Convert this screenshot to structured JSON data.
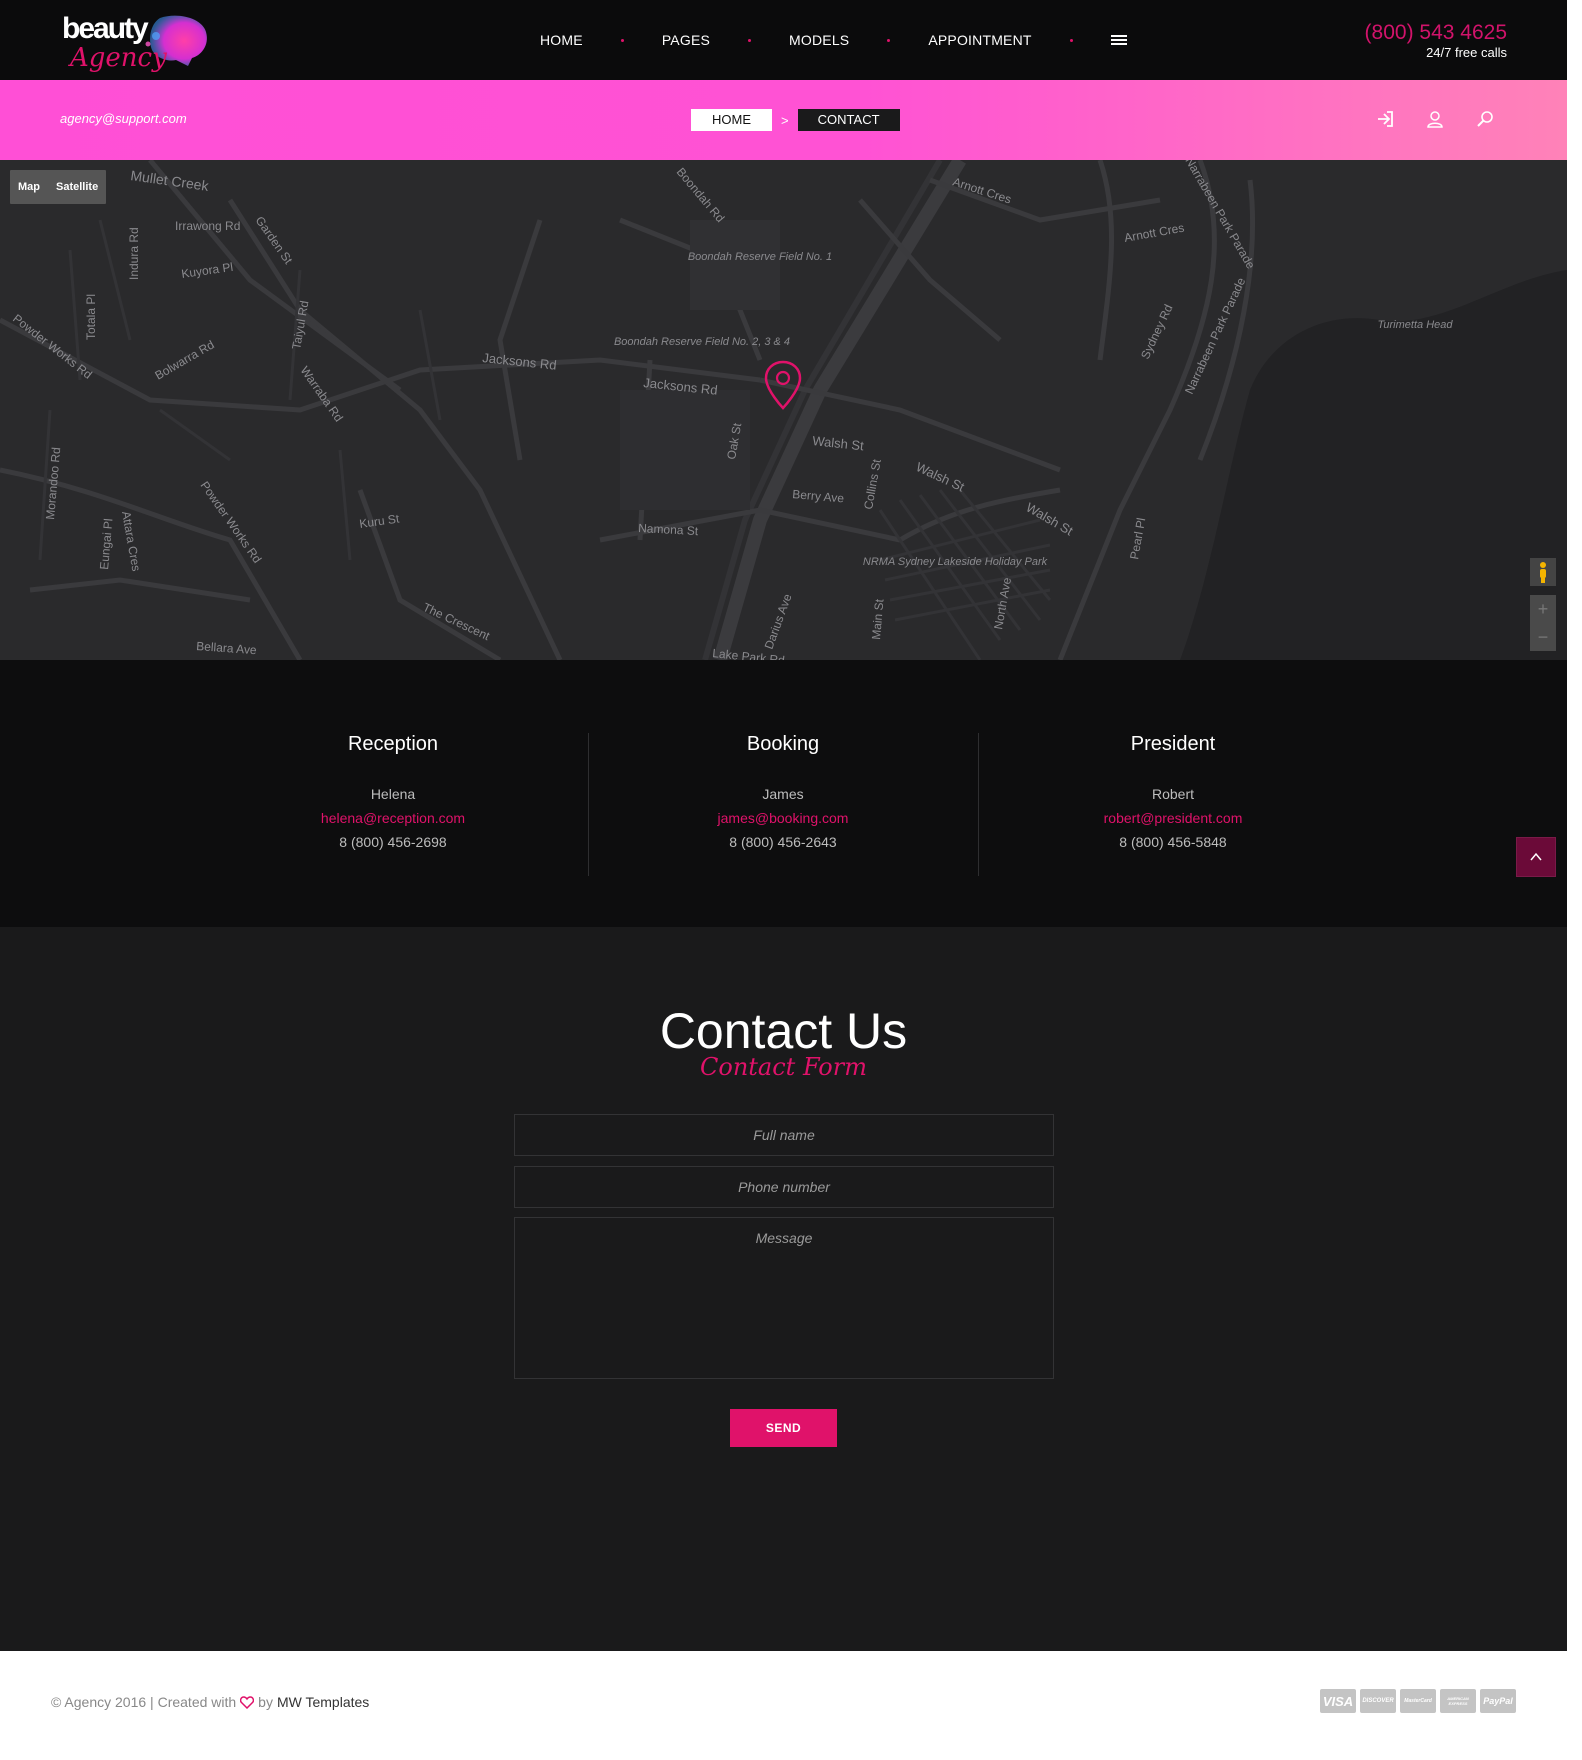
{
  "header": {
    "logo_word": "beauty",
    "logo_script": "Agency",
    "nav": [
      "HOME",
      "PAGES",
      "MODELS",
      "APPOINTMENT"
    ],
    "phone": "(800) 543 4625",
    "phone_sub": "24/7 free calls"
  },
  "topbar": {
    "email": "agency@support.com",
    "breadcrumb_home": "HOME",
    "breadcrumb_sep": ">",
    "breadcrumb_current": "CONTACT"
  },
  "map": {
    "toggle": [
      "Map",
      "Satellite"
    ],
    "labels": {
      "mullet_creek": "Mullet Creek",
      "irrawong_rd": "Irrawong Rd",
      "garden_st": "Garden St",
      "kuyora_pl": "Kuyora Pl",
      "indura_rd": "Indura Rd",
      "totala_pl": "Totala Pl",
      "powder_works_rd": "Powder Works Rd",
      "bolwarra_rd": "Bolwarra Rd",
      "taiyul_rd": "Taiyul Rd",
      "warraba_rd": "Warraba Rd",
      "jacksons_rd": "Jacksons Rd",
      "boondah_rd": "Boondah Rd",
      "boondah_field_1": "Boondah Reserve Field No. 1",
      "boondah_field_234": "Boondah Reserve Field No. 2, 3 & 4",
      "arnott_cres": "Arnott Cres",
      "narrabeen_park_parade": "Narrabeen Park Parade",
      "sydney_rd": "Sydney Rd",
      "turimetta_head": "Turimetta Head",
      "walsh_st": "Walsh St",
      "oak_st": "Oak St",
      "berry_ave": "Berry Ave",
      "collins_st": "Collins St",
      "namona_st": "Namona St",
      "kuru_st": "Kuru St",
      "morandoo_rd": "Morandoo Rd",
      "eungai_pl": "Eungai Pl",
      "attara_cres": "Attara Cres",
      "the_crescent": "The Crescent",
      "bellara_ave": "Bellara Ave",
      "nrma": "NRMA Sydney Lakeside Holiday Park",
      "north_ave": "North Ave",
      "main_st": "Main St",
      "darius_ave": "Darius Ave",
      "lake_park_rd": "Lake Park Rd",
      "pearl_pl": "Pearl Pl"
    }
  },
  "contacts": [
    {
      "title": "Reception",
      "name": "Helena",
      "email": "helena@reception.com",
      "phone": "8 (800) 456-2698"
    },
    {
      "title": "Booking",
      "name": "James",
      "email": "james@booking.com",
      "phone": "8 (800) 456-2643"
    },
    {
      "title": "President",
      "name": "Robert",
      "email": "robert@president.com",
      "phone": "8 (800) 456-5848"
    }
  ],
  "form": {
    "title": "Contact Us",
    "subtitle": "Contact Form",
    "fullname_placeholder": "Full name",
    "phone_placeholder": "Phone number",
    "message_placeholder": "Message",
    "send_label": "SEND"
  },
  "footer": {
    "copyright": "© Agency 2016 | Created with",
    "by": "by",
    "brand": "MW Templates",
    "cards": [
      "VISA",
      "DISCOVER",
      "MasterCard",
      "AMERICAN EXPRESS",
      "PayPal"
    ]
  },
  "colors": {
    "accent": "#e0126a",
    "pink_bar": "#ff4fd6",
    "header_bg": "#0b0b0c",
    "form_bg": "#1a1a1b",
    "map_bg": "#2a2a2c"
  },
  "icons": [
    "menu-icon",
    "login-icon",
    "user-icon",
    "search-icon",
    "map-pin-icon",
    "pegman-icon",
    "zoom-in-icon",
    "zoom-out-icon",
    "chevron-up-icon",
    "heart-icon"
  ]
}
